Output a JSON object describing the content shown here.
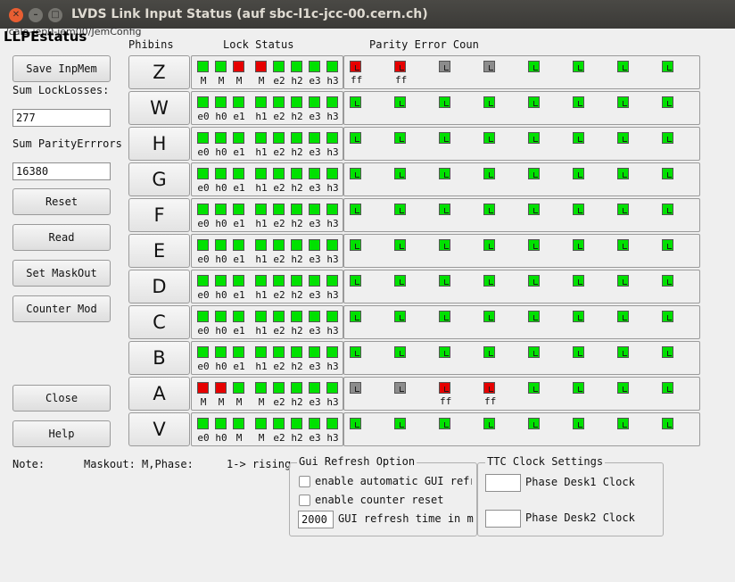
{
  "window": {
    "title": "LVDS Link Input Status (auf sbc-l1c-jcc-00.cern.ch)",
    "path": "/calo-jep0-jem00/JemConfig"
  },
  "app_title": "LLPEstatus",
  "headers": {
    "phibins": "Phibins",
    "lock_status": "Lock Status",
    "parity": "Parity Error Coun"
  },
  "left": {
    "save_label": "Save InpMem",
    "sum_lock_label": "Sum LockLosses:",
    "sum_lock_value": "277",
    "sum_parity_label": "Sum ParityErrrors",
    "sum_parity_value": "16380",
    "reset_label": "Reset",
    "read_label": "Read",
    "maskout_label": "Set MaskOut",
    "counter_label": "Counter Mod",
    "close_label": "Close",
    "help_label": "Help"
  },
  "colors": {
    "green": "#00e100",
    "red": "#e60000",
    "gray": "#8c8c8c"
  },
  "rows": [
    {
      "name": "Z",
      "lock": [
        {
          "c": "green",
          "l": "M"
        },
        {
          "c": "green",
          "l": "M"
        },
        {
          "c": "red",
          "l": "M"
        },
        {
          "c": "red",
          "l": "M"
        },
        {
          "c": "green",
          "l": "e2"
        },
        {
          "c": "green",
          "l": "h2"
        },
        {
          "c": "green",
          "l": "e3"
        },
        {
          "c": "green",
          "l": "h3"
        }
      ],
      "parity": [
        {
          "c": "red",
          "l": "ff"
        },
        {
          "c": "red",
          "l": "ff"
        },
        {
          "c": "gray",
          "l": ""
        },
        {
          "c": "gray",
          "l": ""
        },
        {
          "c": "green",
          "l": ""
        },
        {
          "c": "green",
          "l": ""
        },
        {
          "c": "green",
          "l": ""
        },
        {
          "c": "green",
          "l": ""
        }
      ]
    },
    {
      "name": "W",
      "lock": [
        {
          "c": "green",
          "l": "e0"
        },
        {
          "c": "green",
          "l": "h0"
        },
        {
          "c": "green",
          "l": "e1"
        },
        {
          "c": "green",
          "l": "h1"
        },
        {
          "c": "green",
          "l": "e2"
        },
        {
          "c": "green",
          "l": "h2"
        },
        {
          "c": "green",
          "l": "e3"
        },
        {
          "c": "green",
          "l": "h3"
        }
      ],
      "parity": [
        {
          "c": "green",
          "l": ""
        },
        {
          "c": "green",
          "l": ""
        },
        {
          "c": "green",
          "l": ""
        },
        {
          "c": "green",
          "l": ""
        },
        {
          "c": "green",
          "l": ""
        },
        {
          "c": "green",
          "l": ""
        },
        {
          "c": "green",
          "l": ""
        },
        {
          "c": "green",
          "l": ""
        }
      ]
    },
    {
      "name": "H",
      "lock": [
        {
          "c": "green",
          "l": "e0"
        },
        {
          "c": "green",
          "l": "h0"
        },
        {
          "c": "green",
          "l": "e1"
        },
        {
          "c": "green",
          "l": "h1"
        },
        {
          "c": "green",
          "l": "e2"
        },
        {
          "c": "green",
          "l": "h2"
        },
        {
          "c": "green",
          "l": "e3"
        },
        {
          "c": "green",
          "l": "h3"
        }
      ],
      "parity": [
        {
          "c": "green",
          "l": ""
        },
        {
          "c": "green",
          "l": ""
        },
        {
          "c": "green",
          "l": ""
        },
        {
          "c": "green",
          "l": ""
        },
        {
          "c": "green",
          "l": ""
        },
        {
          "c": "green",
          "l": ""
        },
        {
          "c": "green",
          "l": ""
        },
        {
          "c": "green",
          "l": ""
        }
      ]
    },
    {
      "name": "G",
      "lock": [
        {
          "c": "green",
          "l": "e0"
        },
        {
          "c": "green",
          "l": "h0"
        },
        {
          "c": "green",
          "l": "e1"
        },
        {
          "c": "green",
          "l": "h1"
        },
        {
          "c": "green",
          "l": "e2"
        },
        {
          "c": "green",
          "l": "h2"
        },
        {
          "c": "green",
          "l": "e3"
        },
        {
          "c": "green",
          "l": "h3"
        }
      ],
      "parity": [
        {
          "c": "green",
          "l": ""
        },
        {
          "c": "green",
          "l": ""
        },
        {
          "c": "green",
          "l": ""
        },
        {
          "c": "green",
          "l": ""
        },
        {
          "c": "green",
          "l": ""
        },
        {
          "c": "green",
          "l": ""
        },
        {
          "c": "green",
          "l": ""
        },
        {
          "c": "green",
          "l": ""
        }
      ]
    },
    {
      "name": "F",
      "lock": [
        {
          "c": "green",
          "l": "e0"
        },
        {
          "c": "green",
          "l": "h0"
        },
        {
          "c": "green",
          "l": "e1"
        },
        {
          "c": "green",
          "l": "h1"
        },
        {
          "c": "green",
          "l": "e2"
        },
        {
          "c": "green",
          "l": "h2"
        },
        {
          "c": "green",
          "l": "e3"
        },
        {
          "c": "green",
          "l": "h3"
        }
      ],
      "parity": [
        {
          "c": "green",
          "l": ""
        },
        {
          "c": "green",
          "l": ""
        },
        {
          "c": "green",
          "l": ""
        },
        {
          "c": "green",
          "l": ""
        },
        {
          "c": "green",
          "l": ""
        },
        {
          "c": "green",
          "l": ""
        },
        {
          "c": "green",
          "l": ""
        },
        {
          "c": "green",
          "l": ""
        }
      ]
    },
    {
      "name": "E",
      "lock": [
        {
          "c": "green",
          "l": "e0"
        },
        {
          "c": "green",
          "l": "h0"
        },
        {
          "c": "green",
          "l": "e1"
        },
        {
          "c": "green",
          "l": "h1"
        },
        {
          "c": "green",
          "l": "e2"
        },
        {
          "c": "green",
          "l": "h2"
        },
        {
          "c": "green",
          "l": "e3"
        },
        {
          "c": "green",
          "l": "h3"
        }
      ],
      "parity": [
        {
          "c": "green",
          "l": ""
        },
        {
          "c": "green",
          "l": ""
        },
        {
          "c": "green",
          "l": ""
        },
        {
          "c": "green",
          "l": ""
        },
        {
          "c": "green",
          "l": ""
        },
        {
          "c": "green",
          "l": ""
        },
        {
          "c": "green",
          "l": ""
        },
        {
          "c": "green",
          "l": ""
        }
      ]
    },
    {
      "name": "D",
      "lock": [
        {
          "c": "green",
          "l": "e0"
        },
        {
          "c": "green",
          "l": "h0"
        },
        {
          "c": "green",
          "l": "e1"
        },
        {
          "c": "green",
          "l": "h1"
        },
        {
          "c": "green",
          "l": "e2"
        },
        {
          "c": "green",
          "l": "h2"
        },
        {
          "c": "green",
          "l": "e3"
        },
        {
          "c": "green",
          "l": "h3"
        }
      ],
      "parity": [
        {
          "c": "green",
          "l": ""
        },
        {
          "c": "green",
          "l": ""
        },
        {
          "c": "green",
          "l": ""
        },
        {
          "c": "green",
          "l": ""
        },
        {
          "c": "green",
          "l": ""
        },
        {
          "c": "green",
          "l": ""
        },
        {
          "c": "green",
          "l": ""
        },
        {
          "c": "green",
          "l": ""
        }
      ]
    },
    {
      "name": "C",
      "lock": [
        {
          "c": "green",
          "l": "e0"
        },
        {
          "c": "green",
          "l": "h0"
        },
        {
          "c": "green",
          "l": "e1"
        },
        {
          "c": "green",
          "l": "h1"
        },
        {
          "c": "green",
          "l": "e2"
        },
        {
          "c": "green",
          "l": "h2"
        },
        {
          "c": "green",
          "l": "e3"
        },
        {
          "c": "green",
          "l": "h3"
        }
      ],
      "parity": [
        {
          "c": "green",
          "l": ""
        },
        {
          "c": "green",
          "l": ""
        },
        {
          "c": "green",
          "l": ""
        },
        {
          "c": "green",
          "l": ""
        },
        {
          "c": "green",
          "l": ""
        },
        {
          "c": "green",
          "l": ""
        },
        {
          "c": "green",
          "l": ""
        },
        {
          "c": "green",
          "l": ""
        }
      ]
    },
    {
      "name": "B",
      "lock": [
        {
          "c": "green",
          "l": "e0"
        },
        {
          "c": "green",
          "l": "h0"
        },
        {
          "c": "green",
          "l": "e1"
        },
        {
          "c": "green",
          "l": "h1"
        },
        {
          "c": "green",
          "l": "e2"
        },
        {
          "c": "green",
          "l": "h2"
        },
        {
          "c": "green",
          "l": "e3"
        },
        {
          "c": "green",
          "l": "h3"
        }
      ],
      "parity": [
        {
          "c": "green",
          "l": ""
        },
        {
          "c": "green",
          "l": ""
        },
        {
          "c": "green",
          "l": ""
        },
        {
          "c": "green",
          "l": ""
        },
        {
          "c": "green",
          "l": ""
        },
        {
          "c": "green",
          "l": ""
        },
        {
          "c": "green",
          "l": ""
        },
        {
          "c": "green",
          "l": ""
        }
      ]
    },
    {
      "name": "A",
      "lock": [
        {
          "c": "red",
          "l": "M"
        },
        {
          "c": "red",
          "l": "M"
        },
        {
          "c": "green",
          "l": "M"
        },
        {
          "c": "green",
          "l": "M"
        },
        {
          "c": "green",
          "l": "e2"
        },
        {
          "c": "green",
          "l": "h2"
        },
        {
          "c": "green",
          "l": "e3"
        },
        {
          "c": "green",
          "l": "h3"
        }
      ],
      "parity": [
        {
          "c": "gray",
          "l": ""
        },
        {
          "c": "gray",
          "l": ""
        },
        {
          "c": "red",
          "l": "ff"
        },
        {
          "c": "red",
          "l": "ff"
        },
        {
          "c": "green",
          "l": ""
        },
        {
          "c": "green",
          "l": ""
        },
        {
          "c": "green",
          "l": ""
        },
        {
          "c": "green",
          "l": ""
        }
      ]
    },
    {
      "name": "V",
      "lock": [
        {
          "c": "green",
          "l": "e0"
        },
        {
          "c": "green",
          "l": "h0"
        },
        {
          "c": "green",
          "l": "M"
        },
        {
          "c": "green",
          "l": "M"
        },
        {
          "c": "green",
          "l": "e2"
        },
        {
          "c": "green",
          "l": "h2"
        },
        {
          "c": "green",
          "l": "e3"
        },
        {
          "c": "green",
          "l": "h3"
        }
      ],
      "parity": [
        {
          "c": "green",
          "l": ""
        },
        {
          "c": "green",
          "l": ""
        },
        {
          "c": "green",
          "l": ""
        },
        {
          "c": "green",
          "l": ""
        },
        {
          "c": "green",
          "l": ""
        },
        {
          "c": "green",
          "l": ""
        },
        {
          "c": "green",
          "l": ""
        },
        {
          "c": "green",
          "l": ""
        }
      ]
    }
  ],
  "note": {
    "label": "Note:",
    "text": "Maskout: M,Phase:",
    "rising": "1-> rising"
  },
  "gui_refresh": {
    "title": "Gui Refresh Option",
    "auto_label": "enable automatic GUI refr",
    "counter_reset_label": "enable counter reset",
    "refresh_value": "2000",
    "refresh_label": "GUI refresh time in ms"
  },
  "ttc": {
    "title": "TTC Clock Settings",
    "desk1_label": "Phase Desk1 Clock",
    "desk2_label": "Phase Desk2 Clock",
    "desk1_value": "",
    "desk2_value": ""
  }
}
